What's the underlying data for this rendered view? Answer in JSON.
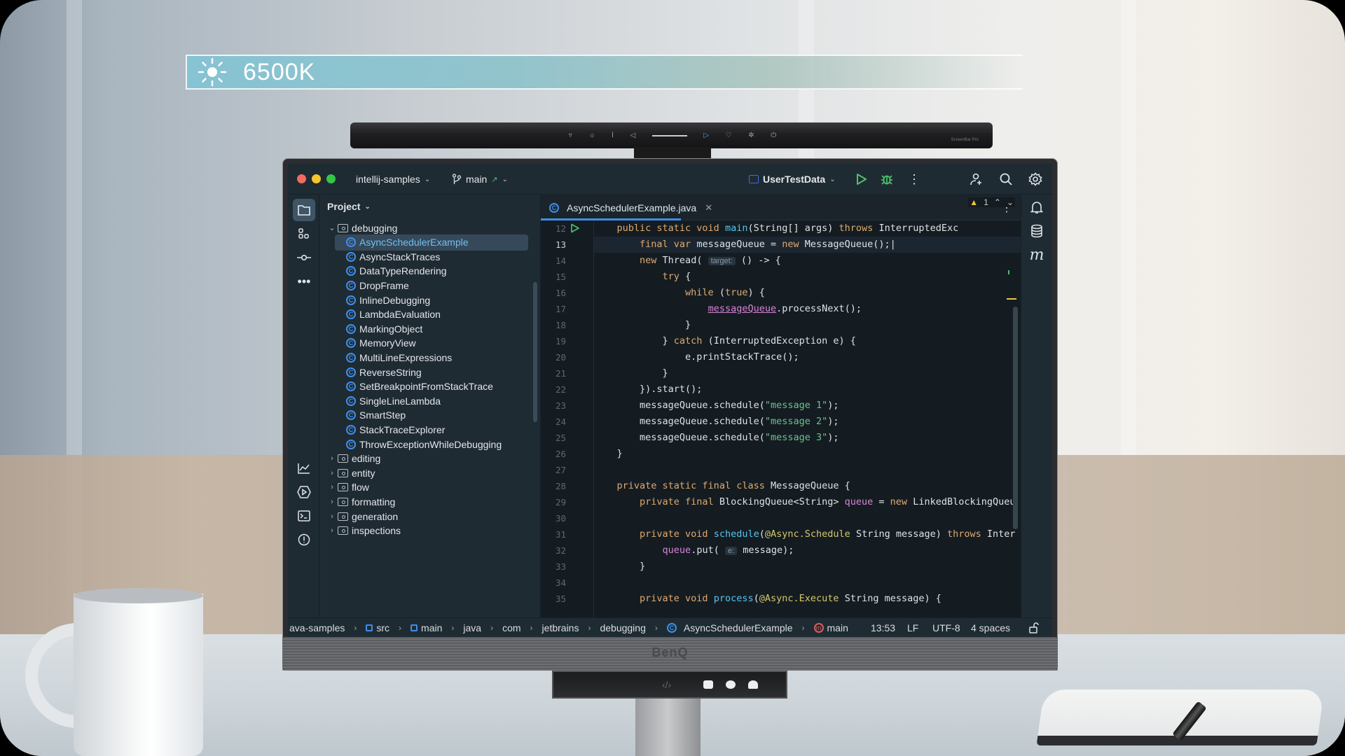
{
  "overlay": {
    "color_temperature": "6500K",
    "icon": "sun-icon"
  },
  "hardware": {
    "monitor_brand": "BenQ",
    "lightbar_label": "ScreenBar Pro"
  },
  "ide": {
    "titlebar": {
      "project": "intellij-samples",
      "branch": "main",
      "run_config": "UserTestData"
    },
    "project_panel": {
      "title": "Project",
      "tree": [
        {
          "type": "folder",
          "label": "debugging",
          "expanded": true,
          "level": 0
        },
        {
          "type": "class",
          "label": "AsyncSchedulerExample",
          "selected": true,
          "level": 1
        },
        {
          "type": "class",
          "label": "AsyncStackTraces",
          "level": 1
        },
        {
          "type": "class",
          "label": "DataTypeRendering",
          "level": 1
        },
        {
          "type": "class",
          "label": "DropFrame",
          "level": 1
        },
        {
          "type": "class",
          "label": "InlineDebugging",
          "level": 1
        },
        {
          "type": "class",
          "label": "LambdaEvaluation",
          "level": 1
        },
        {
          "type": "class",
          "label": "MarkingObject",
          "level": 1
        },
        {
          "type": "class",
          "label": "MemoryView",
          "level": 1
        },
        {
          "type": "class",
          "label": "MultiLineExpressions",
          "level": 1
        },
        {
          "type": "class",
          "label": "ReverseString",
          "level": 1
        },
        {
          "type": "class",
          "label": "SetBreakpointFromStackTrace",
          "level": 1
        },
        {
          "type": "class",
          "label": "SingleLineLambda",
          "level": 1
        },
        {
          "type": "class",
          "label": "SmartStep",
          "level": 1
        },
        {
          "type": "class",
          "label": "StackTraceExplorer",
          "level": 1
        },
        {
          "type": "class",
          "label": "ThrowExceptionWhileDebugging",
          "level": 1
        },
        {
          "type": "folder",
          "label": "editing",
          "expanded": false,
          "level": 0
        },
        {
          "type": "folder",
          "label": "entity",
          "expanded": false,
          "level": 0
        },
        {
          "type": "folder",
          "label": "flow",
          "expanded": false,
          "level": 0
        },
        {
          "type": "folder",
          "label": "formatting",
          "expanded": false,
          "level": 0
        },
        {
          "type": "folder",
          "label": "generation",
          "expanded": false,
          "level": 0
        },
        {
          "type": "folder",
          "label": "inspections",
          "expanded": false,
          "level": 0
        }
      ]
    },
    "editor": {
      "tab": "AsyncSchedulerExample.java",
      "warning_count": "1",
      "current_line": 13,
      "lines": [
        {
          "n": 12,
          "html": "    <span class='kw'>public static void</span> <span class='fn'>main</span>(String[] args) <span class='kw'>throws</span> InterruptedExc"
        },
        {
          "n": 13,
          "html": "        <span class='kw'>final var</span> messageQueue = <span class='kw'>new</span> MessageQueue();|"
        },
        {
          "n": 14,
          "html": "        <span class='kw'>new</span> Thread( <span class='hint'>target:</span> () -> {"
        },
        {
          "n": 15,
          "html": "            <span class='kw'>try</span> {"
        },
        {
          "n": 16,
          "html": "                <span class='kw'>while</span> (<span class='kw'>true</span>) {"
        },
        {
          "n": 17,
          "html": "                    <span class='fld und'>messageQueue</span>.processNext();"
        },
        {
          "n": 18,
          "html": "                }"
        },
        {
          "n": 19,
          "html": "            } <span class='kw'>catch</span> (InterruptedException e) {"
        },
        {
          "n": 20,
          "html": "                e.printStackTrace();"
        },
        {
          "n": 21,
          "html": "            }"
        },
        {
          "n": 22,
          "html": "        }).start();"
        },
        {
          "n": 23,
          "html": "        messageQueue.schedule(<span class='str'>\"message 1\"</span>);"
        },
        {
          "n": 24,
          "html": "        messageQueue.schedule(<span class='str'>\"message 2\"</span>);"
        },
        {
          "n": 25,
          "html": "        messageQueue.schedule(<span class='str'>\"message 3\"</span>);"
        },
        {
          "n": 26,
          "html": "    }"
        },
        {
          "n": 27,
          "html": ""
        },
        {
          "n": 28,
          "html": "    <span class='kw'>private static final class</span> MessageQueue {"
        },
        {
          "n": 29,
          "html": "        <span class='kw'>private final</span> BlockingQueue&lt;String&gt; <span class='fld'>queue</span> = <span class='kw'>new</span> LinkedBlockingQueu"
        },
        {
          "n": 30,
          "html": ""
        },
        {
          "n": 31,
          "html": "        <span class='kw'>private void</span> <span class='fn'>schedule</span>(<span class='ann'>@Async.Schedule</span> String message) <span class='kw'>throws</span> Inter"
        },
        {
          "n": 32,
          "html": "            <span class='fld'>queue</span>.put( <span class='hint'>e:</span> message);"
        },
        {
          "n": 33,
          "html": "        }"
        },
        {
          "n": 34,
          "html": ""
        },
        {
          "n": 35,
          "html": "        <span class='kw'>private void</span> <span class='fn'>process</span>(<span class='ann'>@Async.Execute</span> String message) {"
        }
      ]
    },
    "statusbar": {
      "breadcrumbs": [
        {
          "label": "ava-samples",
          "icon": null
        },
        {
          "label": "src",
          "icon": "module-icon"
        },
        {
          "label": "main",
          "icon": "module-icon"
        },
        {
          "label": "java",
          "icon": null
        },
        {
          "label": "com",
          "icon": null
        },
        {
          "label": "jetbrains",
          "icon": null
        },
        {
          "label": "debugging",
          "icon": null
        },
        {
          "label": "AsyncSchedulerExample",
          "icon": "class-icon"
        },
        {
          "label": "main",
          "icon": "method-icon"
        }
      ],
      "position": "13:53",
      "line_ending": "LF",
      "encoding": "UTF-8",
      "indent": "4 spaces"
    }
  },
  "colors": {
    "accent": "#3e8fea",
    "run_green": "#4bc36a",
    "keyword": "#e0a96d",
    "string": "#6ac48a",
    "function": "#56c5f0"
  }
}
